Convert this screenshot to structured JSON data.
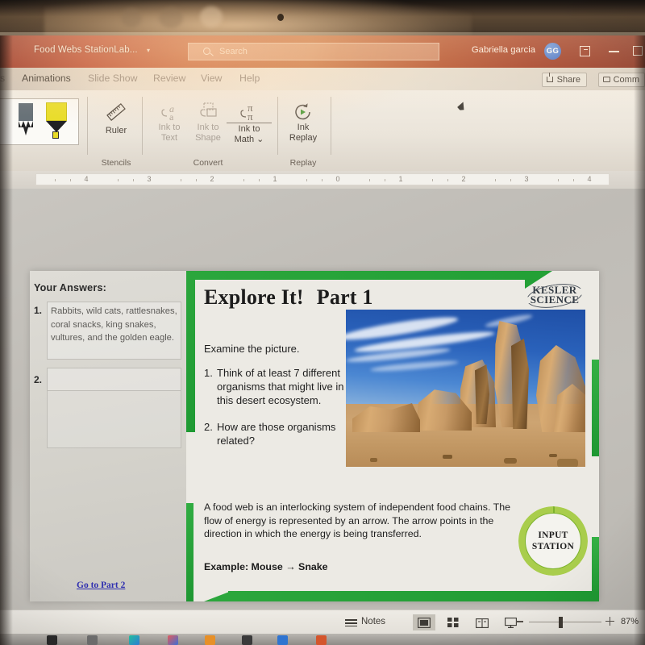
{
  "app": {
    "titlebar": {
      "document_name": "Food Webs StationLab...",
      "dropdown_icon": "chevron-down-icon",
      "search_placeholder": "Search",
      "search_icon": "search-icon",
      "user_name": "Gabriella garcia",
      "avatar_initials": "GG",
      "ribbon_display_icon": "ribbon-display-options-icon",
      "minimize_label": "Minimize",
      "maximize_label": "Maximize",
      "accent_color": "#b4381d"
    },
    "tabs": [
      {
        "label": "s",
        "state": "cutoff"
      },
      {
        "label": "Animations",
        "state": "active"
      },
      {
        "label": "Slide Show",
        "state": "normal"
      },
      {
        "label": "Review",
        "state": "normal"
      },
      {
        "label": "View",
        "state": "normal"
      },
      {
        "label": "Help",
        "state": "normal"
      }
    ],
    "tab_actions": {
      "share_label": "Share",
      "share_icon": "share-icon",
      "comments_label": "Comm",
      "comments_icon": "comment-icon"
    },
    "ribbon": {
      "pen_gallery": {
        "pen_icon": "pencil-icon",
        "highlighter_icon": "highlighter-icon"
      },
      "buttons": [
        {
          "id": "ruler",
          "line1": "Ruler",
          "line2": "",
          "icon": "ruler-icon",
          "enabled": true
        },
        {
          "id": "ink-to-text",
          "line1": "Ink to",
          "line2": "Text",
          "icon": "ink-to-text-icon",
          "enabled": false
        },
        {
          "id": "ink-to-shape",
          "line1": "Ink to",
          "line2": "Shape",
          "icon": "ink-to-shape-icon",
          "enabled": false
        },
        {
          "id": "ink-to-math",
          "line1": "Ink to",
          "line2": "Math ⌄",
          "icon": "ink-to-math-icon",
          "enabled": true
        },
        {
          "id": "ink-replay",
          "line1": "Ink",
          "line2": "Replay",
          "icon": "ink-replay-icon",
          "enabled": true
        }
      ],
      "groups": [
        {
          "label": "Stencils"
        },
        {
          "label": "Convert"
        },
        {
          "label": "Replay"
        }
      ]
    },
    "ruler": {
      "ticks": [
        "4",
        "3",
        "2",
        "1",
        "0",
        "1",
        "2",
        "3",
        "4"
      ]
    },
    "statusbar": {
      "notes_label": "Notes",
      "notes_icon": "notes-icon",
      "views": [
        {
          "id": "normal",
          "icon": "normal-view-icon",
          "active": true
        },
        {
          "id": "slide-sorter",
          "icon": "slide-sorter-icon",
          "active": false
        },
        {
          "id": "reading-view",
          "icon": "reading-view-icon",
          "active": false
        },
        {
          "id": "slide-show",
          "icon": "slide-show-icon",
          "active": false
        }
      ],
      "zoom_out_icon": "zoom-out-icon",
      "zoom_in_icon": "zoom-in-icon",
      "zoom_percent": "87%"
    }
  },
  "answers_panel": {
    "heading": "Your  Answers:",
    "items": [
      {
        "number": "1.",
        "text": "Rabbits, wild cats, rattlesnakes, coral snacks, king snakes, vultures, and the golden eagle."
      },
      {
        "number": "2.",
        "text": ""
      }
    ],
    "link_label": "Go to Part 2"
  },
  "slide": {
    "title_main": "Explore It!",
    "title_part": "Part 1",
    "logo": {
      "line1": "KESLER",
      "line2": "SCIENCE"
    },
    "intro": "Examine the picture.",
    "questions": [
      {
        "number": "1.",
        "text": "Think of at least 7 different organisms that might live in this desert ecosystem."
      },
      {
        "number": "2.",
        "text": "How are those organisms related?"
      }
    ],
    "image_alt": "desert-rock-formation-photo",
    "paragraph": "A food web is an interlocking system of independent food chains. The flow of energy is represented by an arrow. The arrow points in the direction in which the energy is being transferred.",
    "example": "Example:  Mouse → Snake",
    "badge": {
      "line1": "INPUT",
      "line2": "STATION"
    },
    "accent_color": "#23a036"
  }
}
